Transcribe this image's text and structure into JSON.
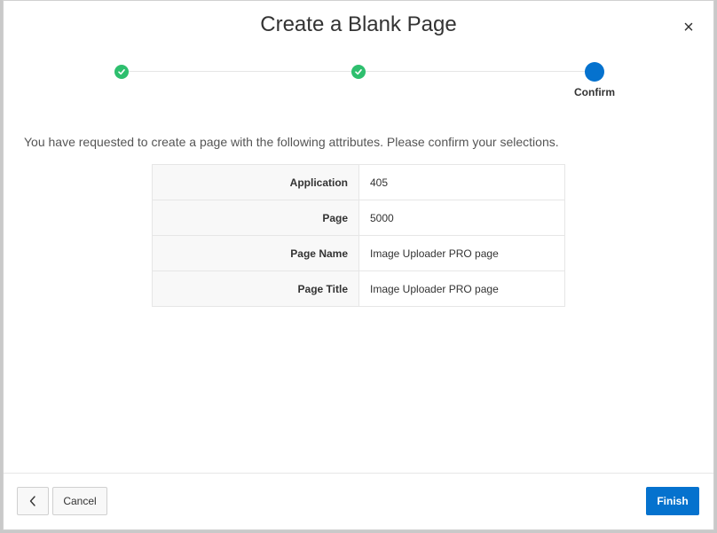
{
  "dialog": {
    "title": "Create a Blank Page",
    "close_symbol": "×"
  },
  "wizard": {
    "steps": [
      {
        "status": "complete",
        "label": ""
      },
      {
        "status": "complete",
        "label": ""
      },
      {
        "status": "current",
        "label": "Confirm"
      }
    ],
    "complete_color": "#2ebf6e",
    "current_color": "#0572ce"
  },
  "main": {
    "intro": "You have requested to create a page with the following attributes. Please confirm your selections.",
    "attributes": [
      {
        "label": "Application",
        "value": "405"
      },
      {
        "label": "Page",
        "value": "5000"
      },
      {
        "label": "Page Name",
        "value": "Image Uploader PRO page"
      },
      {
        "label": "Page Title",
        "value": "Image Uploader PRO page"
      }
    ]
  },
  "footer": {
    "back_icon": "chevron-left-icon",
    "cancel_label": "Cancel",
    "finish_label": "Finish",
    "accent": "#0572ce"
  }
}
